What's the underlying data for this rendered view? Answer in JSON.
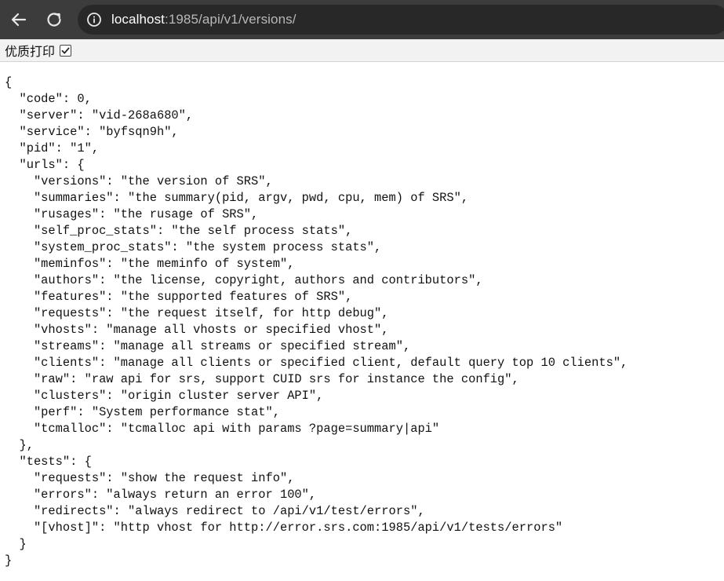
{
  "browser": {
    "url_host": "localhost",
    "url_rest": ":1985/api/v1/versions/",
    "back_icon": "arrow-left-icon",
    "reload_icon": "reload-icon",
    "info_icon": "info-icon"
  },
  "pretty_print": {
    "label": "优质打印",
    "checked": true
  },
  "json_lines": [
    "{",
    "  \"code\": 0,",
    "  \"server\": \"vid-268a680\",",
    "  \"service\": \"byfsqn9h\",",
    "  \"pid\": \"1\",",
    "  \"urls\": {",
    "    \"versions\": \"the version of SRS\",",
    "    \"summaries\": \"the summary(pid, argv, pwd, cpu, mem) of SRS\",",
    "    \"rusages\": \"the rusage of SRS\",",
    "    \"self_proc_stats\": \"the self process stats\",",
    "    \"system_proc_stats\": \"the system process stats\",",
    "    \"meminfos\": \"the meminfo of system\",",
    "    \"authors\": \"the license, copyright, authors and contributors\",",
    "    \"features\": \"the supported features of SRS\",",
    "    \"requests\": \"the request itself, for http debug\",",
    "    \"vhosts\": \"manage all vhosts or specified vhost\",",
    "    \"streams\": \"manage all streams or specified stream\",",
    "    \"clients\": \"manage all clients or specified client, default query top 10 clients\",",
    "    \"raw\": \"raw api for srs, support CUID srs for instance the config\",",
    "    \"clusters\": \"origin cluster server API\",",
    "    \"perf\": \"System performance stat\",",
    "    \"tcmalloc\": \"tcmalloc api with params ?page=summary|api\"",
    "  },",
    "  \"tests\": {",
    "    \"requests\": \"show the request info\",",
    "    \"errors\": \"always return an error 100\",",
    "    \"redirects\": \"always redirect to /api/v1/test/errors\",",
    "    \"[vhost]\": \"http vhost for http://error.srs.com:1985/api/v1/tests/errors\"",
    "  }",
    "}"
  ]
}
